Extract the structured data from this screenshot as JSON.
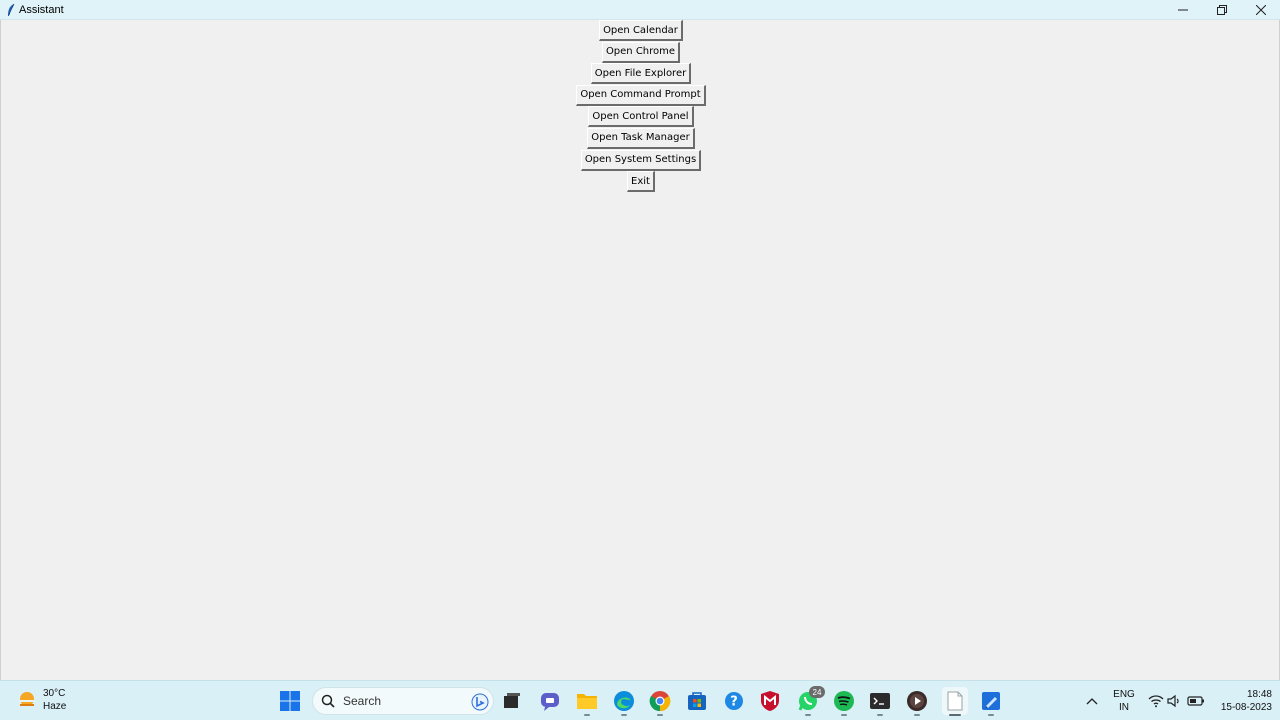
{
  "window": {
    "title": "Assistant",
    "controls": {
      "minimize": "–",
      "restore": "❐",
      "close": "✕"
    }
  },
  "buttons": [
    {
      "name": "open-calendar-button",
      "label": "Open Calendar"
    },
    {
      "name": "open-chrome-button",
      "label": "Open Chrome"
    },
    {
      "name": "open-file-explorer-button",
      "label": "Open File Explorer"
    },
    {
      "name": "open-command-prompt-button",
      "label": "Open Command Prompt"
    },
    {
      "name": "open-control-panel-button",
      "label": "Open Control Panel"
    },
    {
      "name": "open-task-manager-button",
      "label": "Open Task Manager"
    },
    {
      "name": "open-system-settings-button",
      "label": "Open System Settings"
    },
    {
      "name": "exit-button",
      "label": "Exit"
    }
  ],
  "taskbar": {
    "weather": {
      "temperature": "30°C",
      "condition": "Haze"
    },
    "search": {
      "label": "Search"
    },
    "whatsapp_badge": "24",
    "tray": {
      "language": "ENG",
      "region": "IN",
      "time": "18:48",
      "date": "15-08-2023"
    }
  },
  "colors": {
    "titlebar_bg": "#dff3f8",
    "window_bg": "#f0f0f0",
    "taskbar_bg": "#d9f0f6"
  }
}
